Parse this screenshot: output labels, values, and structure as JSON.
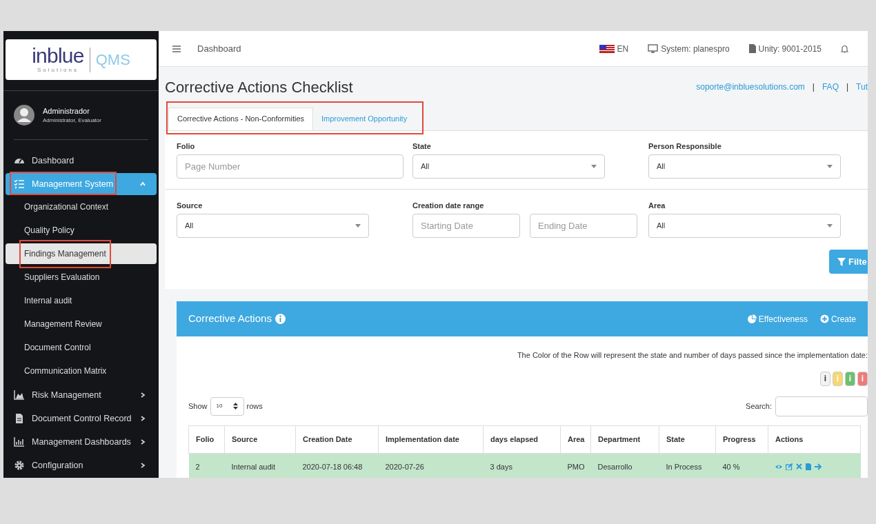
{
  "logo": {
    "brand": "inblue",
    "sub": "Solutions",
    "product": "QMS"
  },
  "user": {
    "name": "Administrador",
    "roles": "Administrator, Evaluator"
  },
  "sidebar": {
    "items": [
      {
        "label": "Dashboard",
        "selected": false,
        "highlighted": false
      },
      {
        "label": "Management System",
        "selected": true,
        "highlighted": true,
        "expanded": true,
        "children": [
          {
            "label": "Organizational Context",
            "selected": false,
            "highlighted": false
          },
          {
            "label": "Quality Policy",
            "selected": false,
            "highlighted": false
          },
          {
            "label": "Findings Management",
            "selected": true,
            "highlighted": true
          },
          {
            "label": "Suppliers Evaluation",
            "selected": false,
            "highlighted": false
          },
          {
            "label": "Internal audit",
            "selected": false,
            "highlighted": false
          },
          {
            "label": "Management Review",
            "selected": false,
            "highlighted": false
          },
          {
            "label": "Document Control",
            "selected": false,
            "highlighted": false
          },
          {
            "label": "Communication Matrix",
            "selected": false,
            "highlighted": false
          }
        ]
      },
      {
        "label": "Risk Management",
        "selected": false,
        "highlighted": false,
        "expanded": false
      },
      {
        "label": "Document Control Record",
        "selected": false,
        "highlighted": false,
        "expanded": false
      },
      {
        "label": "Management Dashboards",
        "selected": false,
        "highlighted": false,
        "expanded": false
      },
      {
        "label": "Configuration",
        "selected": false,
        "highlighted": false,
        "expanded": false
      }
    ]
  },
  "topbar": {
    "breadcrumb": "Dashboard",
    "language": "EN",
    "system": "System: planespro",
    "unity": "Unity: 9001-2015"
  },
  "page": {
    "title": "Corrective Actions Checklist",
    "links": [
      "soporte@inbluesolutions.com",
      "FAQ",
      "Tut"
    ],
    "separators": [
      "|",
      "|"
    ]
  },
  "tabs": {
    "highlighted": true,
    "items": [
      {
        "label": "Corrective Actions - Non-Conformities",
        "selected": true
      },
      {
        "label": "Improvement Opportunity",
        "selected": false
      }
    ]
  },
  "filters": [
    {
      "kind": "text",
      "label": "Folio",
      "placeholder": "Page Number"
    },
    {
      "kind": "select",
      "label": "State",
      "value": "All"
    },
    {
      "kind": "select",
      "label": "Person Responsible",
      "value": "All"
    },
    {
      "kind": "select",
      "label": "Source",
      "value": "All"
    },
    {
      "kind": "range",
      "label": "Creation date range",
      "placeholders": [
        "Starting Date",
        "Ending Date"
      ]
    },
    {
      "kind": "select",
      "label": "Area",
      "value": "All"
    }
  ],
  "filter_button": "Filte",
  "panel": {
    "title": "Corrective Actions",
    "actions": [
      "Effectiveness",
      "Create"
    ],
    "legend_text": "The Color of the Row will represent the state and number of days passed since the implementation date:",
    "legend": [
      {
        "label": "i",
        "color": "#f2f2f2"
      },
      {
        "label": "i",
        "color": "#f7d774"
      },
      {
        "label": "i",
        "color": "#6cc070"
      },
      {
        "label": "i",
        "color": "#ee7b7b"
      }
    ],
    "show_label": "Show",
    "page_size": "10",
    "rows_label": "rows",
    "search_label": "Search:"
  },
  "table": {
    "columns": [
      "Folio",
      "Source",
      "Creation Date",
      "Implementation date",
      "days elapsed",
      "Area",
      "Department",
      "State",
      "Progress",
      "Actions"
    ],
    "rows": [
      {
        "color": "#c3e6cb",
        "cells": [
          "2",
          "Internal audit",
          "2020-07-18 06:48",
          "2020-07-26",
          "3 days",
          "PMO",
          "Desarrollo",
          "In Process",
          "40 %"
        ]
      }
    ]
  }
}
